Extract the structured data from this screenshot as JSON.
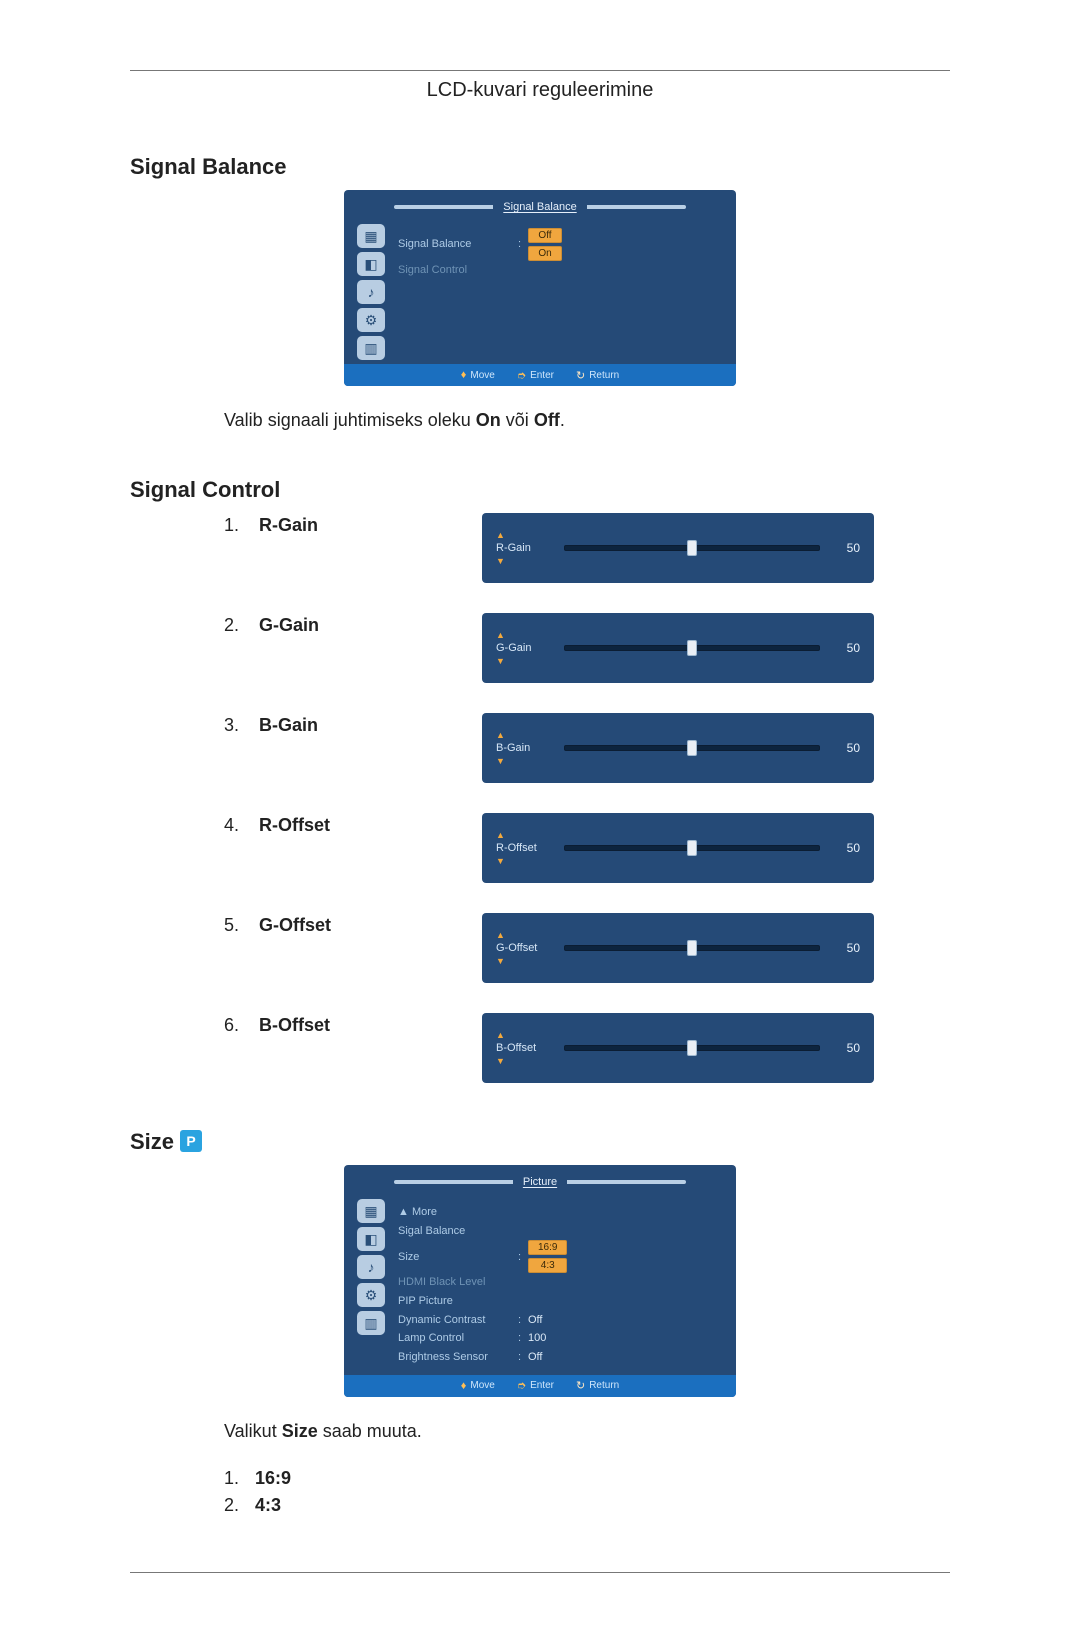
{
  "header": {
    "title": "LCD-kuvari reguleerimine"
  },
  "sections": {
    "signal_balance": {
      "title": "Signal Balance"
    },
    "signal_control": {
      "title": "Signal Control"
    },
    "size": {
      "title": "Size",
      "badge": "P"
    }
  },
  "signal_balance_text": {
    "line": "Valib signaali juhtimiseks oleku ",
    "on": "On",
    "mid": " või ",
    "off": "Off",
    "end": "."
  },
  "signal_control_items": [
    {
      "num": "1.",
      "label": "R-Gain",
      "slider_label": "R-Gain",
      "value": "50"
    },
    {
      "num": "2.",
      "label": "G-Gain",
      "slider_label": "G-Gain",
      "value": "50"
    },
    {
      "num": "3.",
      "label": "B-Gain",
      "slider_label": "B-Gain",
      "value": "50"
    },
    {
      "num": "4.",
      "label": "R-Offset",
      "slider_label": "R-Offset",
      "value": "50"
    },
    {
      "num": "5.",
      "label": "G-Offset",
      "slider_label": "G-Offset",
      "value": "50"
    },
    {
      "num": "6.",
      "label": "B-Offset",
      "slider_label": "B-Offset",
      "value": "50"
    }
  ],
  "osd_signal_balance": {
    "title": "Signal Balance",
    "rows": [
      {
        "key": "Signal Balance",
        "sep": ":",
        "opt_off": "Off",
        "opt_on": "On"
      },
      {
        "key": "Signal Control",
        "dim": true
      }
    ],
    "footer": {
      "move": "Move",
      "enter": "Enter",
      "return": "Return"
    },
    "icons": [
      "image-icon",
      "picture-icon",
      "audio-icon",
      "settings-icon",
      "multi-icon"
    ]
  },
  "osd_picture": {
    "title": "Picture",
    "rows": [
      {
        "key": "▲ More"
      },
      {
        "key": "Sigal Balance"
      },
      {
        "key": "Size",
        "sep": ":",
        "opt_a": "16:9",
        "opt_b": "4:3"
      },
      {
        "key": "HDMI Black Level",
        "dim": true
      },
      {
        "key": "PIP Picture"
      },
      {
        "key": "Dynamic Contrast",
        "sep": ":",
        "val": "Off"
      },
      {
        "key": "Lamp Control",
        "sep": ":",
        "val": "100"
      },
      {
        "key": "Brightness Sensor",
        "sep": ":",
        "val": "Off"
      }
    ],
    "footer": {
      "move": "Move",
      "enter": "Enter",
      "return": "Return"
    },
    "icons": [
      "image-icon",
      "picture-icon",
      "audio-icon",
      "settings-icon",
      "multi-icon"
    ]
  },
  "size_text": {
    "line_a": "Valikut ",
    "size_word": "Size",
    "line_b": " saab muuta."
  },
  "size_options": [
    {
      "num": "1.",
      "val": "16:9"
    },
    {
      "num": "2.",
      "val": "4:3"
    }
  ]
}
